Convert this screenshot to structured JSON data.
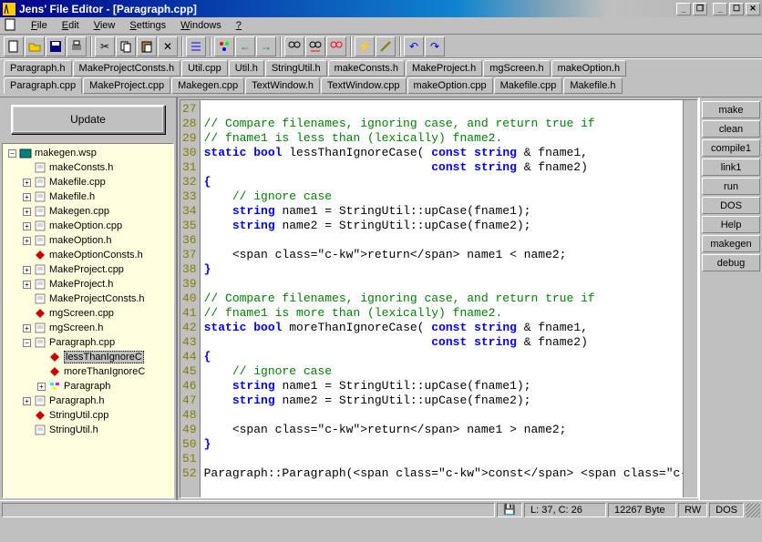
{
  "title": "Jens' File Editor - [Paragraph.cpp]",
  "menu": [
    "File",
    "Edit",
    "View",
    "Settings",
    "Windows",
    "?"
  ],
  "tabs_row1": [
    "Paragraph.h",
    "MakeProjectConsts.h",
    "Util.cpp",
    "Util.h",
    "StringUtil.h",
    "makeConsts.h",
    "MakeProject.h",
    "mgScreen.h",
    "makeOption.h"
  ],
  "tabs_row2": [
    "Paragraph.cpp",
    "MakeProject.cpp",
    "Makegen.cpp",
    "TextWindow.h",
    "TextWindow.cpp",
    "makeOption.cpp",
    "Makefile.cpp",
    "Makefile.h"
  ],
  "active_tab": "Paragraph.cpp",
  "update_label": "Update",
  "right_buttons": [
    "make",
    "clean",
    "compile1",
    "link1",
    "run",
    "DOS",
    "Help",
    "makegen",
    "debug"
  ],
  "tree": [
    {
      "depth": 0,
      "exp": "-",
      "icon": "wsp",
      "label": "makegen.wsp"
    },
    {
      "depth": 1,
      "exp": " ",
      "icon": "h",
      "label": "makeConsts.h"
    },
    {
      "depth": 1,
      "exp": "+",
      "icon": "cpp",
      "label": "Makefile.cpp"
    },
    {
      "depth": 1,
      "exp": "+",
      "icon": "h",
      "label": "Makefile.h"
    },
    {
      "depth": 1,
      "exp": "+",
      "icon": "cpp",
      "label": "Makegen.cpp"
    },
    {
      "depth": 1,
      "exp": "+",
      "icon": "cpp",
      "label": "makeOption.cpp"
    },
    {
      "depth": 1,
      "exp": "+",
      "icon": "h",
      "label": "makeOption.h"
    },
    {
      "depth": 1,
      "exp": " ",
      "icon": "red",
      "label": "makeOptionConsts.h"
    },
    {
      "depth": 1,
      "exp": "+",
      "icon": "cpp",
      "label": "MakeProject.cpp"
    },
    {
      "depth": 1,
      "exp": "+",
      "icon": "h",
      "label": "MakeProject.h"
    },
    {
      "depth": 1,
      "exp": " ",
      "icon": "h",
      "label": "MakeProjectConsts.h"
    },
    {
      "depth": 1,
      "exp": " ",
      "icon": "red",
      "label": "mgScreen.cpp"
    },
    {
      "depth": 1,
      "exp": "+",
      "icon": "h",
      "label": "mgScreen.h"
    },
    {
      "depth": 1,
      "exp": "-",
      "icon": "cpp",
      "label": "Paragraph.cpp"
    },
    {
      "depth": 2,
      "exp": " ",
      "icon": "red",
      "label": "lessThanIgnoreC",
      "sel": true
    },
    {
      "depth": 2,
      "exp": " ",
      "icon": "red",
      "label": "moreThanIgnoreC"
    },
    {
      "depth": 2,
      "exp": "+",
      "icon": "cls",
      "label": "Paragraph"
    },
    {
      "depth": 1,
      "exp": "+",
      "icon": "h",
      "label": "Paragraph.h"
    },
    {
      "depth": 1,
      "exp": " ",
      "icon": "red",
      "label": "StringUtil.cpp"
    },
    {
      "depth": 1,
      "exp": " ",
      "icon": "h",
      "label": "StringUtil.h"
    }
  ],
  "code": {
    "first_line": 27,
    "lines": [
      {
        "t": "",
        "cls": ""
      },
      {
        "t": "// Compare filenames, ignoring case, and return true if",
        "cls": "cm"
      },
      {
        "t": "// fname1 is less than (lexically) fname2.",
        "cls": "cm"
      },
      {
        "t": "static bool lessThanIgnoreCase( const string & fname1,",
        "cls": "sig"
      },
      {
        "t": "                                const string & fname2)",
        "cls": "sig"
      },
      {
        "t": "{",
        "cls": "kw"
      },
      {
        "t": "    // ignore case",
        "cls": "cm"
      },
      {
        "t": "    string name1 = StringUtil::upCase(fname1);",
        "cls": "stmt1"
      },
      {
        "t": "    string name2 = StringUtil::upCase(fname2);",
        "cls": "stmt2"
      },
      {
        "t": "",
        "cls": ""
      },
      {
        "t": "    return name1 < name2;",
        "cls": "ret"
      },
      {
        "t": "}",
        "cls": "kw"
      },
      {
        "t": "",
        "cls": ""
      },
      {
        "t": "// Compare filenames, ignoring case, and return true if",
        "cls": "cm"
      },
      {
        "t": "// fname1 is more than (lexically) fname2.",
        "cls": "cm"
      },
      {
        "t": "static bool moreThanIgnoreCase( const string & fname1,",
        "cls": "sig"
      },
      {
        "t": "                                const string & fname2)",
        "cls": "sig"
      },
      {
        "t": "{",
        "cls": "kw"
      },
      {
        "t": "    // ignore case",
        "cls": "cm"
      },
      {
        "t": "    string name1 = StringUtil::upCase(fname1);",
        "cls": "stmt1"
      },
      {
        "t": "    string name2 = StringUtil::upCase(fname2);",
        "cls": "stmt2"
      },
      {
        "t": "",
        "cls": ""
      },
      {
        "t": "    return name1 > name2;",
        "cls": "ret"
      },
      {
        "t": "}",
        "cls": "kw"
      },
      {
        "t": "",
        "cls": ""
      },
      {
        "t": "Paragraph::Paragraph(const vector<string> & theLines)",
        "cls": "ctor"
      }
    ]
  },
  "status": {
    "save_icon": "💾",
    "pos": "L: 37, C: 26",
    "size": "12267 Byte",
    "rw": "RW",
    "dos": "DOS"
  }
}
